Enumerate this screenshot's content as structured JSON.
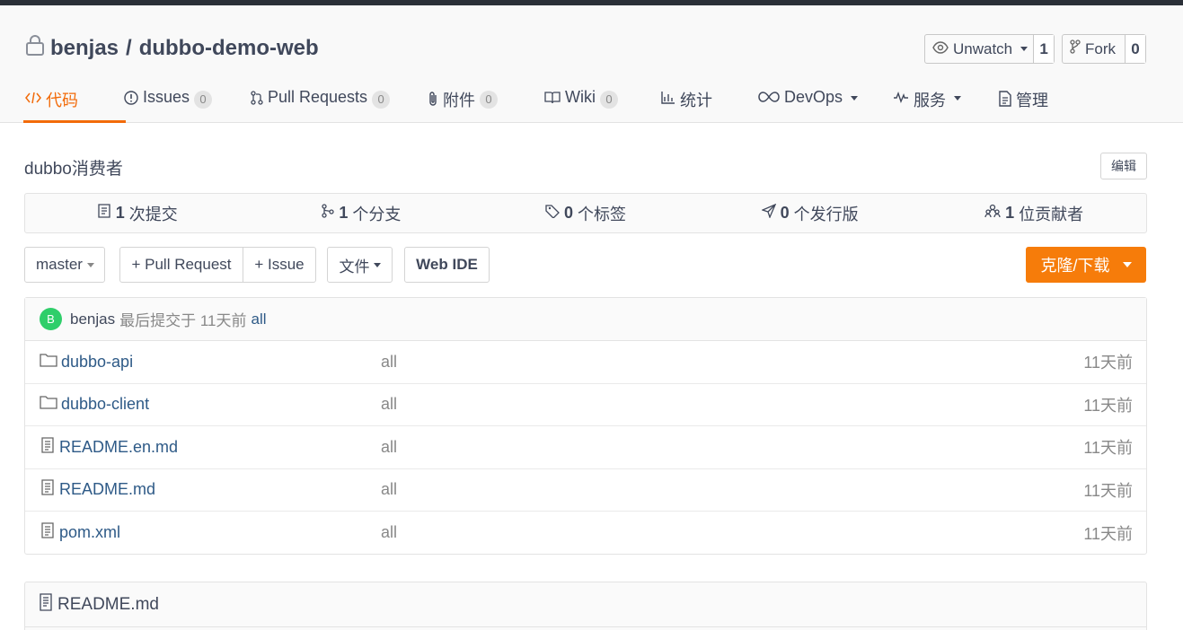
{
  "repo": {
    "owner": "benjas",
    "separator": "/",
    "name": "dubbo-demo-web"
  },
  "watch": {
    "label": "Unwatch",
    "count": "1"
  },
  "fork": {
    "label": "Fork",
    "count": "0"
  },
  "tabs": [
    {
      "label": "代码",
      "icon": "code-icon"
    },
    {
      "label": "Issues",
      "badge": "0",
      "icon": "issue-icon"
    },
    {
      "label": "Pull Requests",
      "badge": "0",
      "icon": "pull-request-icon"
    },
    {
      "label": "附件",
      "badge": "0",
      "icon": "paperclip-icon"
    },
    {
      "label": "Wiki",
      "badge": "0",
      "icon": "book-icon"
    },
    {
      "label": "统计",
      "icon": "bar-chart-icon"
    },
    {
      "label": "DevOps",
      "icon": "infinity-icon"
    },
    {
      "label": "服务",
      "icon": "pulse-icon"
    },
    {
      "label": "管理",
      "icon": "document-icon"
    }
  ],
  "description": "dubbo消费者",
  "edit_label": "编辑",
  "stats": [
    {
      "count": "1",
      "label": "次提交",
      "icon": "commit-icon"
    },
    {
      "count": "1",
      "label": "个分支",
      "icon": "branch-icon"
    },
    {
      "count": "0",
      "label": "个标签",
      "icon": "tag-icon"
    },
    {
      "count": "0",
      "label": "个发行版",
      "icon": "release-icon"
    },
    {
      "count": "1",
      "label": "位贡献者",
      "icon": "contributors-icon"
    }
  ],
  "toolbar": {
    "branch": "master",
    "pull_request": "+ Pull Request",
    "issue": "+ Issue",
    "file": "文件",
    "web_ide": "Web IDE",
    "clone": "克隆/下载"
  },
  "last_commit": {
    "avatar": "B",
    "author": "benjas",
    "text": "最后提交于 11天前",
    "message": "all"
  },
  "files": [
    {
      "name": "dubbo-api",
      "type": "folder",
      "message": "all",
      "time": "11天前"
    },
    {
      "name": "dubbo-client",
      "type": "folder",
      "message": "all",
      "time": "11天前"
    },
    {
      "name": "README.en.md",
      "type": "file",
      "message": "all",
      "time": "11天前"
    },
    {
      "name": "README.md",
      "type": "file",
      "message": "all",
      "time": "11天前"
    },
    {
      "name": "pom.xml",
      "type": "file",
      "message": "all",
      "time": "11天前"
    }
  ],
  "readme": {
    "title": "README.md"
  },
  "colors": {
    "accent": "#f26b0a",
    "clone_button": "#f67c0a",
    "link": "#2e5a87",
    "avatar": "#2fce6a"
  }
}
